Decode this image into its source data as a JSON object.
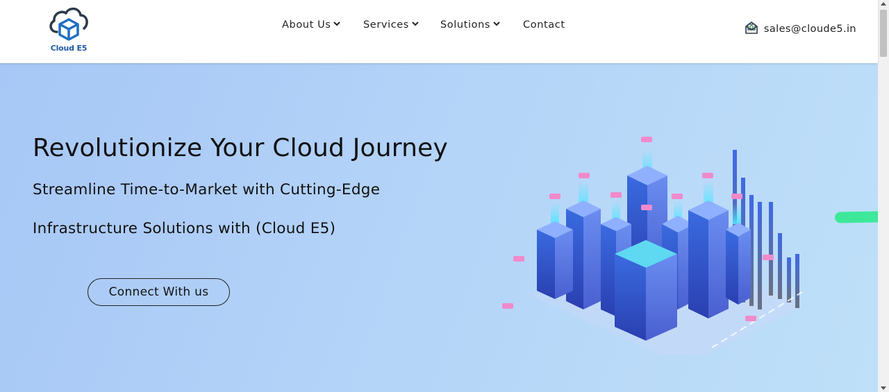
{
  "brand": {
    "name": "Cloud E5",
    "color": "#1f5aa6"
  },
  "nav": {
    "items": [
      {
        "label": "About Us",
        "has_dropdown": true
      },
      {
        "label": "Services",
        "has_dropdown": true
      },
      {
        "label": "Solutions",
        "has_dropdown": true
      },
      {
        "label": "Contact",
        "has_dropdown": false
      }
    ]
  },
  "contact": {
    "email": "sales@cloude5.in",
    "icon": "mail-icon"
  },
  "hero": {
    "title": "Revolutionize Your Cloud Journey",
    "subtitle_line1": "Streamline Time-to-Market with Cutting-Edge",
    "subtitle_line2": "Infrastructure Solutions with (Cloud E5)",
    "cta_label": "Connect With us",
    "illustration": "isometric-cloud-city-illustration"
  },
  "colors": {
    "hero_gradient_start": "#a7c7f6",
    "hero_gradient_end": "#bfe0f8",
    "accent_green": "#3ee89a"
  }
}
